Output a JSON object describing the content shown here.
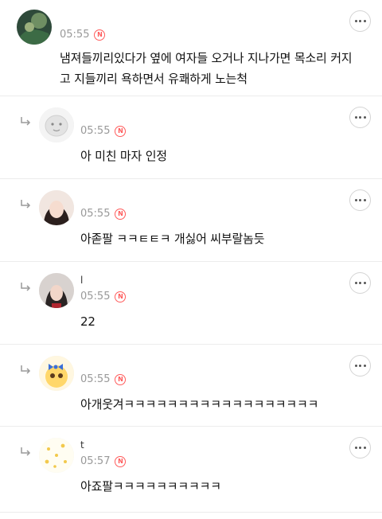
{
  "comments": [
    {
      "nickname": "",
      "time": "05:55",
      "new_badge": "N",
      "text": "냄져들끼리있다가 옆에 여자들 오거나 지나가면 목소리 커지고 지들끼리 욕하면서 유쾌하게 노는척",
      "is_reply": false
    },
    {
      "nickname": "",
      "time": "05:55",
      "new_badge": "N",
      "text": "아 미친 마자 인정",
      "is_reply": true
    },
    {
      "nickname": "",
      "time": "05:55",
      "new_badge": "N",
      "text": "아졷팔 ㅋㅋㅌㅌㅋ 개싫어 씨부랄놈듯",
      "is_reply": true
    },
    {
      "nickname": "l",
      "time": "05:55",
      "new_badge": "N",
      "text": "22",
      "is_reply": true
    },
    {
      "nickname": "",
      "time": "05:55",
      "new_badge": "N",
      "text": "아개웃겨ㅋㅋㅋㅋㅋㅋㅋㅋㅋㅋㅋㅋㅋㅋㅋㅋㅋㅋ",
      "is_reply": true
    },
    {
      "nickname": "t",
      "time": "05:57",
      "new_badge": "N",
      "text": "아죠팔ㅋㅋㅋㅋㅋㅋㅋㅋㅋㅋ",
      "is_reply": true
    }
  ],
  "icons": {
    "more": "more-icon",
    "reply": "reply-arrow-icon",
    "new": "new-badge-icon"
  },
  "colors": {
    "badge": "#ff5b5b",
    "time": "#999999",
    "divider": "#ececec"
  }
}
